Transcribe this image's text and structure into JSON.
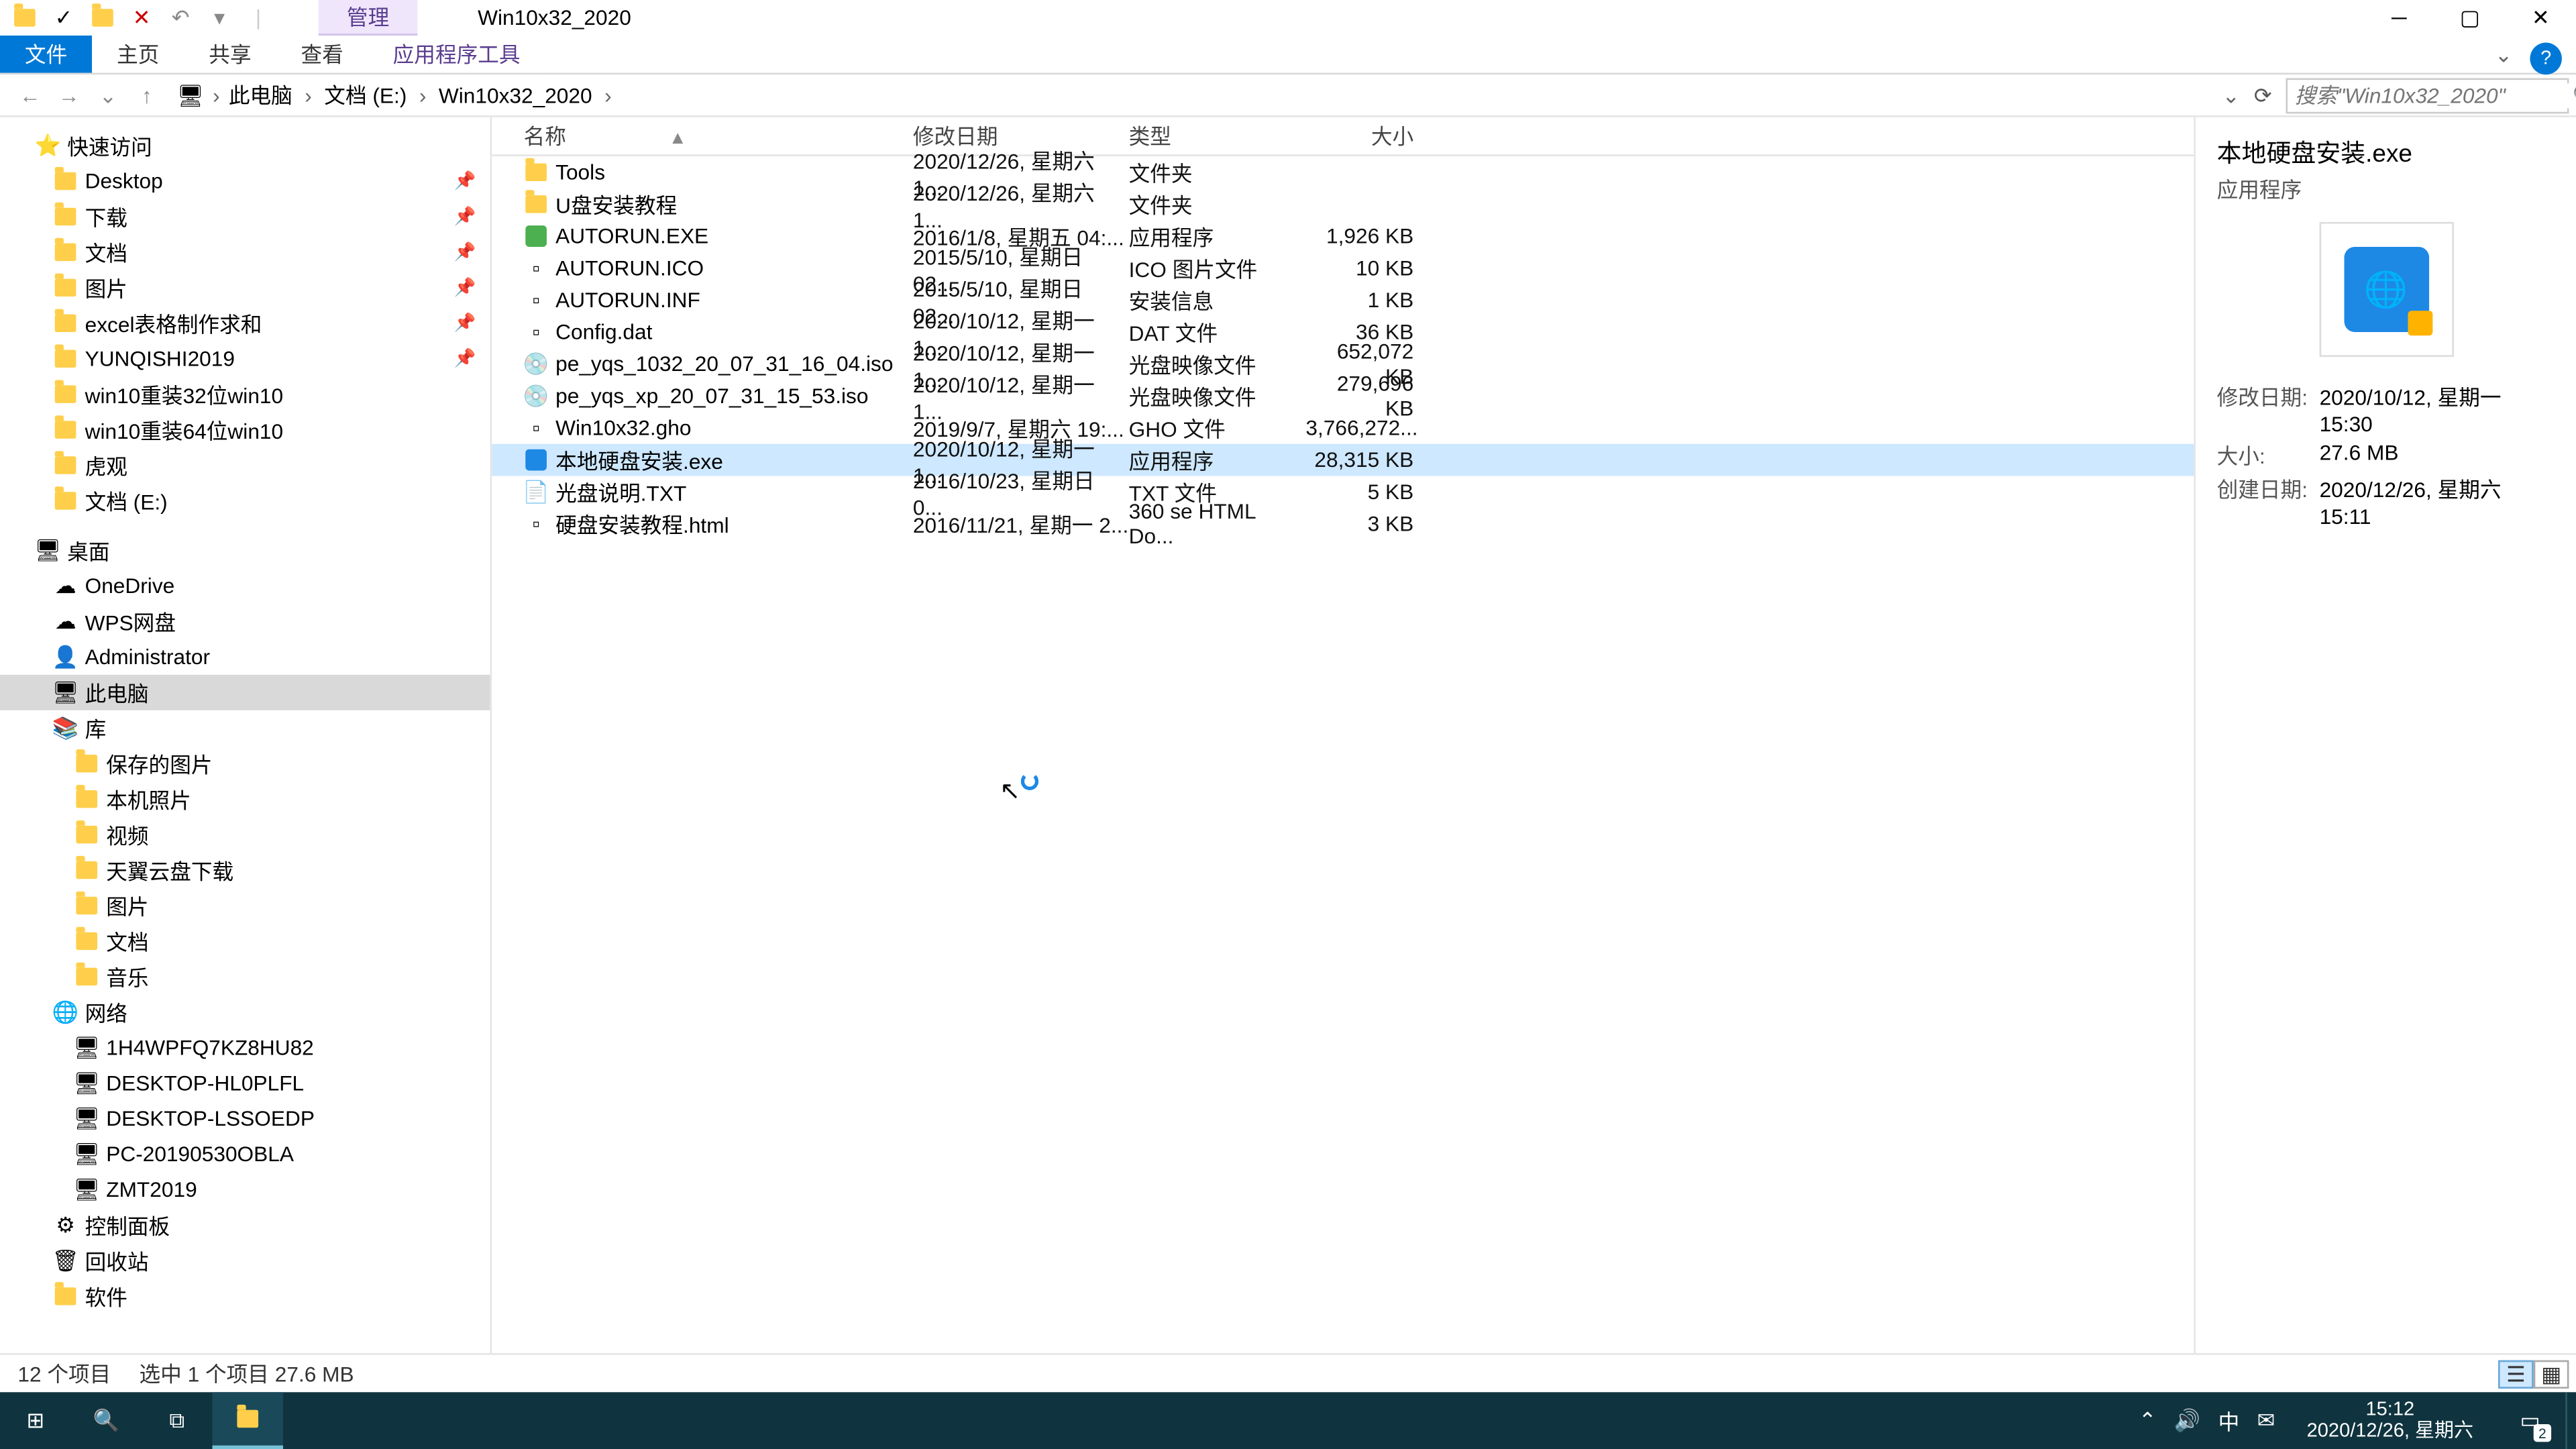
{
  "title": "Win10x32_2020",
  "ribbon_context": "管理",
  "ribbon_tabs": {
    "file": "文件",
    "home": "主页",
    "share": "共享",
    "view": "查看",
    "app_tools": "应用程序工具"
  },
  "breadcrumbs": [
    "此电脑",
    "文档 (E:)",
    "Win10x32_2020"
  ],
  "search_placeholder": "搜索\"Win10x32_2020\"",
  "tree": {
    "quick_access": "快速访问",
    "quick_items": [
      {
        "label": "Desktop",
        "pin": true
      },
      {
        "label": "下载",
        "pin": true
      },
      {
        "label": "文档",
        "pin": true
      },
      {
        "label": "图片",
        "pin": true
      },
      {
        "label": "excel表格制作求和",
        "pin": true
      },
      {
        "label": "YUNQISHI2019",
        "pin": true
      },
      {
        "label": "win10重装32位win10",
        "pin": false
      },
      {
        "label": "win10重装64位win10",
        "pin": false
      },
      {
        "label": "虎观",
        "pin": false
      },
      {
        "label": "文档 (E:)",
        "pin": false
      }
    ],
    "desktop": "桌面",
    "desktop_items": [
      "OneDrive",
      "WPS网盘",
      "Administrator",
      "此电脑",
      "库"
    ],
    "library_items": [
      "保存的图片",
      "本机照片",
      "视频",
      "天翼云盘下载",
      "图片",
      "文档",
      "音乐"
    ],
    "network": "网络",
    "network_items": [
      "1H4WPFQ7KZ8HU82",
      "DESKTOP-HL0PLFL",
      "DESKTOP-LSSOEDP",
      "PC-20190530OBLA",
      "ZMT2019"
    ],
    "control_panel": "控制面板",
    "recycle": "回收站",
    "software": "软件"
  },
  "columns": {
    "name": "名称",
    "date": "修改日期",
    "type": "类型",
    "size": "大小"
  },
  "files": [
    {
      "name": "Tools",
      "date": "2020/12/26, 星期六 1...",
      "type": "文件夹",
      "size": "",
      "icon": "folder"
    },
    {
      "name": "U盘安装教程",
      "date": "2020/12/26, 星期六 1...",
      "type": "文件夹",
      "size": "",
      "icon": "folder"
    },
    {
      "name": "AUTORUN.EXE",
      "date": "2016/1/8, 星期五 04:...",
      "type": "应用程序",
      "size": "1,926 KB",
      "icon": "exe"
    },
    {
      "name": "AUTORUN.ICO",
      "date": "2015/5/10, 星期日 02...",
      "type": "ICO 图片文件",
      "size": "10 KB",
      "icon": "ico"
    },
    {
      "name": "AUTORUN.INF",
      "date": "2015/5/10, 星期日 02...",
      "type": "安装信息",
      "size": "1 KB",
      "icon": "inf"
    },
    {
      "name": "Config.dat",
      "date": "2020/10/12, 星期一 1...",
      "type": "DAT 文件",
      "size": "36 KB",
      "icon": "dat"
    },
    {
      "name": "pe_yqs_1032_20_07_31_16_04.iso",
      "date": "2020/10/12, 星期一 1...",
      "type": "光盘映像文件",
      "size": "652,072 KB",
      "icon": "iso"
    },
    {
      "name": "pe_yqs_xp_20_07_31_15_53.iso",
      "date": "2020/10/12, 星期一 1...",
      "type": "光盘映像文件",
      "size": "279,696 KB",
      "icon": "iso"
    },
    {
      "name": "Win10x32.gho",
      "date": "2019/9/7, 星期六 19:...",
      "type": "GHO 文件",
      "size": "3,766,272...",
      "icon": "gho"
    },
    {
      "name": "本地硬盘安装.exe",
      "date": "2020/10/12, 星期一 1...",
      "type": "应用程序",
      "size": "28,315 KB",
      "icon": "exe-blue",
      "selected": true
    },
    {
      "name": "光盘说明.TXT",
      "date": "2016/10/23, 星期日 0...",
      "type": "TXT 文件",
      "size": "5 KB",
      "icon": "txt"
    },
    {
      "name": "硬盘安装教程.html",
      "date": "2016/11/21, 星期一 2...",
      "type": "360 se HTML Do...",
      "size": "3 KB",
      "icon": "html"
    }
  ],
  "details": {
    "name": "本地硬盘安装.exe",
    "type": "应用程序",
    "rows": [
      {
        "label": "修改日期:",
        "value": "2020/10/12, 星期一 15:30"
      },
      {
        "label": "大小:",
        "value": "27.6 MB"
      },
      {
        "label": "创建日期:",
        "value": "2020/12/26, 星期六 15:11"
      }
    ]
  },
  "status": {
    "count": "12 个项目",
    "selection": "选中 1 个项目  27.6 MB"
  },
  "taskbar": {
    "time": "15:12",
    "date": "2020/12/26, 星期六",
    "ime": "中",
    "notif_count": "2"
  }
}
